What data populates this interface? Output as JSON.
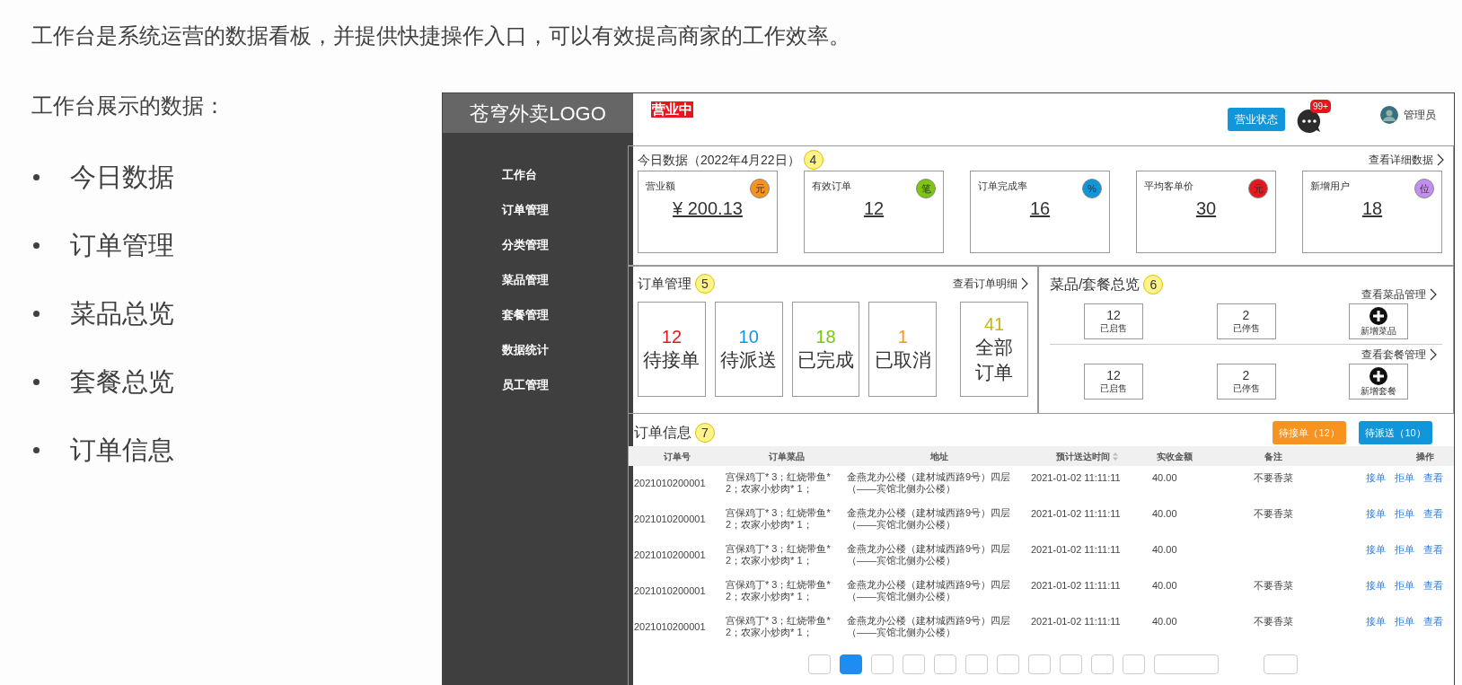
{
  "slide": {
    "intro": "工作台是系统运营的数据看板，并提供快捷操作入口，可以有效提高商家的工作效率。",
    "list_title": "工作台展示的数据：",
    "bullets": [
      "今日数据",
      "订单管理",
      "菜品总览",
      "套餐总览",
      "订单信息"
    ]
  },
  "app": {
    "logo": "苍穹外卖LOGO",
    "status_badge": "营业中",
    "sidebar": {
      "items": [
        "工作台",
        "订单管理",
        "分类管理",
        "菜品管理",
        "套餐管理",
        "数据统计",
        "员工管理"
      ]
    },
    "header": {
      "status_button": "营业状态",
      "notification_count": "99+",
      "user": "管理员"
    },
    "today": {
      "title": "今日数据（2022年4月22日）",
      "marker": "4",
      "link": "查看详细数据",
      "cards": [
        {
          "label": "营业额",
          "value": "¥ 200.13",
          "unit": "元",
          "color": "#f7931e"
        },
        {
          "label": "有效订单",
          "value": "12",
          "unit": "笔",
          "color": "#7ac70c"
        },
        {
          "label": "订单完成率",
          "value": "16",
          "unit": "%",
          "color": "#1296db"
        },
        {
          "label": "平均客单价",
          "value": "30",
          "unit": "元",
          "color": "#e5171f"
        },
        {
          "label": "新增用户",
          "value": "18",
          "unit": "位",
          "color": "#c48ef0"
        }
      ]
    },
    "orders": {
      "title": "订单管理",
      "marker": "5",
      "link": "查看订单明细",
      "stats": [
        {
          "count": "12",
          "label": "待接单",
          "color": "#e5171f"
        },
        {
          "count": "10",
          "label": "待派送",
          "color": "#1296db"
        },
        {
          "count": "18",
          "label": "已完成",
          "color": "#7ac70c"
        },
        {
          "count": "1",
          "label": "已取消",
          "color": "#f7931e"
        },
        {
          "count": "41",
          "label": "全部订单",
          "color": "#c8b414"
        }
      ]
    },
    "overview": {
      "title": "菜品/套餐总览",
      "marker": "6",
      "groups": [
        {
          "link": "查看菜品管理",
          "items": [
            {
              "kind": "count",
              "count": "12",
              "label": "已启售"
            },
            {
              "kind": "count",
              "count": "2",
              "label": "已停售"
            },
            {
              "kind": "add",
              "label": "新增菜品"
            }
          ]
        },
        {
          "link": "查看套餐管理",
          "items": [
            {
              "kind": "count",
              "count": "12",
              "label": "已启售"
            },
            {
              "kind": "count",
              "count": "2",
              "label": "已停售"
            },
            {
              "kind": "add",
              "label": "新增套餐"
            }
          ]
        }
      ]
    },
    "order_info": {
      "title": "订单信息",
      "marker": "7",
      "buttons": [
        {
          "label": "待接单（12）",
          "color": "#f7931e"
        },
        {
          "label": "待派送（10）",
          "color": "#1296db"
        }
      ],
      "table": {
        "columns": [
          {
            "label": "订单号",
            "sortable": false
          },
          {
            "label": "订单菜品",
            "sortable": false
          },
          {
            "label": "地址",
            "sortable": false
          },
          {
            "label": "预计送达时间",
            "sortable": true
          },
          {
            "label": "实收金额",
            "sortable": false
          },
          {
            "label": "备注",
            "sortable": false
          },
          {
            "label": "操作",
            "sortable": false
          }
        ],
        "rows": [
          {
            "id": "2021010200001",
            "dishes": "宫保鸡丁* 3；红烧带鱼* 2；农家小炒肉* 1；",
            "address": "金燕龙办公楼（建材城西路9号）四层（——宾馆北侧办公楼）",
            "time": "2021-01-02 11:11:11",
            "amount": "40.00",
            "remark": "不要香菜",
            "actions": [
              "接单",
              "拒单",
              "查看"
            ]
          },
          {
            "id": "2021010200001",
            "dishes": "宫保鸡丁* 3；红烧带鱼* 2；农家小炒肉* 1；",
            "address": "金燕龙办公楼（建材城西路9号）四层（——宾馆北侧办公楼）",
            "time": "2021-01-02 11:11:11",
            "amount": "40.00",
            "remark": "不要香菜",
            "actions": [
              "接单",
              "拒单",
              "查看"
            ]
          },
          {
            "id": "2021010200001",
            "dishes": "宫保鸡丁* 3；红烧带鱼* 2；农家小炒肉* 1；",
            "address": "金燕龙办公楼（建材城西路9号）四层（——宾馆北侧办公楼）",
            "time": "2021-01-02 11:11:11",
            "amount": "40.00",
            "actions": [
              "接单",
              "拒单",
              "查看"
            ]
          },
          {
            "id": "2021010200001",
            "dishes": "宫保鸡丁* 3；红烧带鱼* 2；农家小炒肉* 1；",
            "address": "金燕龙办公楼（建材城西路9号）四层（——宾馆北侧办公楼）",
            "time": "2021-01-02 11:11:11",
            "amount": "40.00",
            "remark": "不要香菜",
            "actions": [
              "接单",
              "拒单",
              "查看"
            ]
          },
          {
            "id": "2021010200001",
            "dishes": "宫保鸡丁* 3；红烧带鱼* 2；农家小炒肉* 1；",
            "address": "金燕龙办公楼（建材城西路9号）四层（——宾馆北侧办公楼）",
            "time": "2021-01-02 11:11:11",
            "amount": "40.00",
            "remark": "不要香菜",
            "actions": [
              "接单",
              "拒单",
              "查看"
            ]
          }
        ]
      },
      "pagination": {
        "pages": [
          {
            "selected": true
          },
          {
            "selected": false
          },
          {
            "selected": false
          },
          {
            "selected": false
          },
          {
            "selected": false
          },
          {
            "selected": false
          },
          {
            "selected": false
          },
          {
            "selected": false
          },
          {
            "selected": false
          }
        ]
      }
    }
  }
}
